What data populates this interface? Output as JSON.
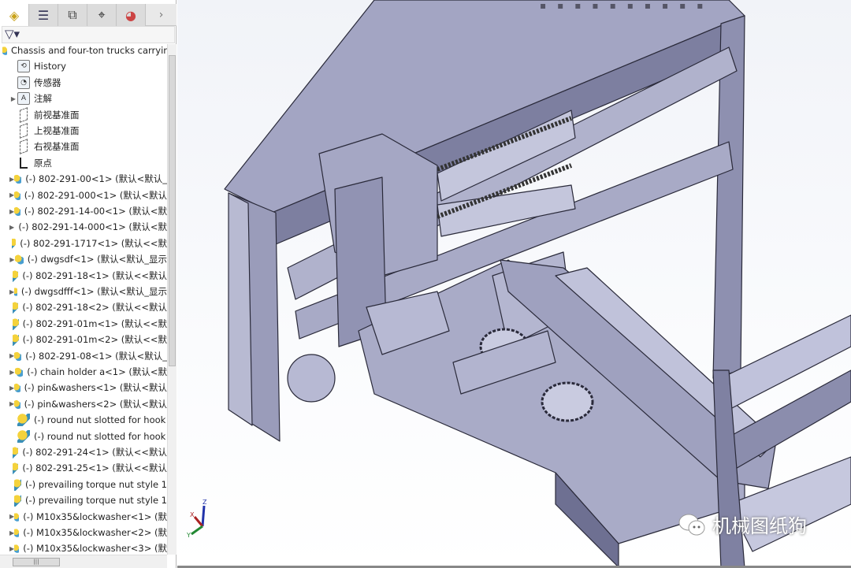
{
  "tabs": [
    {
      "name": "featuremanager",
      "icon": "assembly-tree-icon",
      "glyph": "◈"
    },
    {
      "name": "propertymanager",
      "icon": "property-list-icon",
      "glyph": "☰"
    },
    {
      "name": "configurationmanager",
      "icon": "configuration-icon",
      "glyph": "⧉"
    },
    {
      "name": "dimxpert",
      "icon": "crosshair-icon",
      "glyph": "⌖"
    },
    {
      "name": "display-manager",
      "icon": "color-wheel-icon",
      "glyph": "◕"
    }
  ],
  "tabs_more": "›",
  "filter_glyph": "▽▾",
  "tree": [
    {
      "label": "Chassis and four-ton trucks carryir",
      "icon": "assembly",
      "arrow": false,
      "indent": 0
    },
    {
      "label": "History",
      "icon": "folder-history",
      "arrow": false
    },
    {
      "label": "传感器",
      "icon": "folder-sensor",
      "arrow": false
    },
    {
      "label": "注解",
      "icon": "folder-annotation",
      "arrow": true
    },
    {
      "label": "前视基准面",
      "icon": "plane",
      "arrow": false
    },
    {
      "label": "上视基准面",
      "icon": "plane",
      "arrow": false
    },
    {
      "label": "右视基准面",
      "icon": "plane",
      "arrow": false
    },
    {
      "label": "原点",
      "icon": "origin",
      "arrow": false
    },
    {
      "label": "(-) 802-291-00<1> (默认<默认_",
      "icon": "asm",
      "arrow": true
    },
    {
      "label": "(-) 802-291-000<1> (默认<默认",
      "icon": "asm",
      "arrow": true
    },
    {
      "label": "(-) 802-291-14-00<1> (默认<默",
      "icon": "asm",
      "arrow": true
    },
    {
      "label": "(-) 802-291-14-000<1> (默认<默",
      "icon": "asm",
      "arrow": true
    },
    {
      "label": "(-) 802-291-1717<1> (默认<<默",
      "icon": "part",
      "arrow": false
    },
    {
      "label": "(-) dwgsdf<1> (默认<默认_显示",
      "icon": "asm",
      "arrow": true
    },
    {
      "label": "(-) 802-291-18<1> (默认<<默认",
      "icon": "part",
      "arrow": false
    },
    {
      "label": "(-) dwgsdfff<1> (默认<默认_显示",
      "icon": "asm",
      "arrow": true
    },
    {
      "label": "(-) 802-291-18<2> (默认<<默认",
      "icon": "part",
      "arrow": false
    },
    {
      "label": "(-) 802-291-01m<1> (默认<<默",
      "icon": "part",
      "arrow": false
    },
    {
      "label": "(-) 802-291-01m<2> (默认<<默",
      "icon": "part",
      "arrow": false
    },
    {
      "label": "(-) 802-291-08<1> (默认<默认_",
      "icon": "asm",
      "arrow": true
    },
    {
      "label": "(-) chain holder a<1> (默认<默",
      "icon": "asm",
      "arrow": true
    },
    {
      "label": "(-) pin&washers<1> (默认<默认",
      "icon": "asm",
      "arrow": true
    },
    {
      "label": "(-) pin&washers<2> (默认<默认",
      "icon": "asm",
      "arrow": true
    },
    {
      "label": "(-) round nut slotted for hook",
      "icon": "part",
      "arrow": false
    },
    {
      "label": "(-) round nut slotted for hook",
      "icon": "part",
      "arrow": false
    },
    {
      "label": "(-) 802-291-24<1> (默认<<默认",
      "icon": "part",
      "arrow": false
    },
    {
      "label": "(-) 802-291-25<1> (默认<<默认",
      "icon": "part",
      "arrow": false
    },
    {
      "label": "(-) prevailing torque nut style 1",
      "icon": "part",
      "arrow": false
    },
    {
      "label": "(-) prevailing torque nut style 1",
      "icon": "part",
      "arrow": false
    },
    {
      "label": "(-) M10x35&lockwasher<1> (默",
      "icon": "asm",
      "arrow": true
    },
    {
      "label": "(-) M10x35&lockwasher<2> (默",
      "icon": "asm",
      "arrow": true
    },
    {
      "label": "(-) M10x35&lockwasher<3> (默",
      "icon": "asm",
      "arrow": true
    }
  ],
  "triad": {
    "x": "X",
    "y": "Y",
    "z": "Z"
  },
  "watermark": "机械图纸狗",
  "colors": {
    "model": "#9d9fbd",
    "model_dark": "#5f6080",
    "accent_blue": "#3a8fb8"
  }
}
